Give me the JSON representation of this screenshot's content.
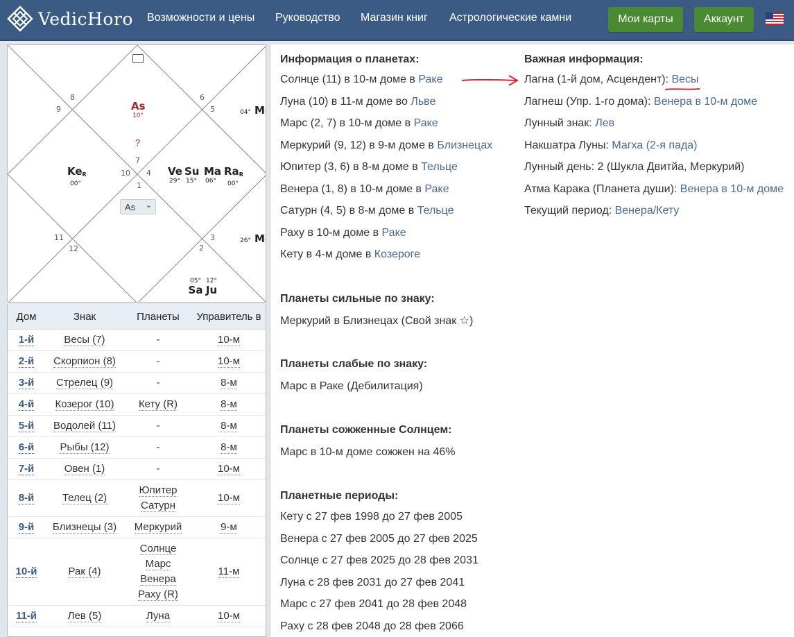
{
  "nav": {
    "logo_text": "VedicHoro",
    "links": [
      "Возможности и цены",
      "Руководство",
      "Магазин книг",
      "Астрологические камни"
    ],
    "my_charts": "Мои карты",
    "account": "Аккаунт"
  },
  "chart": {
    "house_numbers": [
      "1",
      "2",
      "3",
      "4",
      "5",
      "6",
      "7",
      "8",
      "9",
      "10",
      "11",
      "12"
    ],
    "asc": {
      "abbr": "As",
      "deg": "10°"
    },
    "question": "?",
    "ketu": {
      "abbr": "Ke",
      "deg": "00°",
      "sup": "R"
    },
    "venus": {
      "abbr": "Ve",
      "deg": "29°"
    },
    "sun": {
      "abbr": "Su",
      "deg": "15°"
    },
    "mars": {
      "abbr": "Ma",
      "deg": "06°"
    },
    "rahu": {
      "abbr": "Ra",
      "deg": "00°",
      "sup": "R"
    },
    "moon": {
      "abbr": "Mo",
      "deg": "04°"
    },
    "mercury": {
      "abbr": "Me",
      "deg": "26°"
    },
    "saturn": {
      "abbr": "Sa",
      "deg": "05°"
    },
    "jupiter": {
      "abbr": "Ju",
      "deg": "12°"
    },
    "select_value": "As"
  },
  "table": {
    "headers": [
      "Дом",
      "Знак",
      "Планеты",
      "Управитель в"
    ],
    "rows": [
      {
        "dom": "1-й",
        "sign": "Весы (7)",
        "planets": [
          "-"
        ],
        "lord": "10-м"
      },
      {
        "dom": "2-й",
        "sign": "Скорпион (8)",
        "planets": [
          "-"
        ],
        "lord": "10-м"
      },
      {
        "dom": "3-й",
        "sign": "Стрелец (9)",
        "planets": [
          "-"
        ],
        "lord": "8-м"
      },
      {
        "dom": "4-й",
        "sign": "Козерог (10)",
        "planets": [
          "Кету (R)"
        ],
        "lord": "8-м"
      },
      {
        "dom": "5-й",
        "sign": "Водолей (11)",
        "planets": [
          "-"
        ],
        "lord": "8-м"
      },
      {
        "dom": "6-й",
        "sign": "Рыбы (12)",
        "planets": [
          "-"
        ],
        "lord": "8-м"
      },
      {
        "dom": "7-й",
        "sign": "Овен (1)",
        "planets": [
          "-"
        ],
        "lord": "10-м"
      },
      {
        "dom": "8-й",
        "sign": "Телец (2)",
        "planets": [
          "Юпитер",
          "Сатурн"
        ],
        "lord": "10-м"
      },
      {
        "dom": "9-й",
        "sign": "Близнецы (3)",
        "planets": [
          "Меркурий"
        ],
        "lord": "9-м"
      },
      {
        "dom": "10-й",
        "sign": "Рак (4)",
        "planets": [
          "Солнце",
          "Марс",
          "Венера",
          "Раху (R)"
        ],
        "lord": "11-м"
      },
      {
        "dom": "11-й",
        "sign": "Лев (5)",
        "planets": [
          "Луна"
        ],
        "lord": "10-м"
      }
    ]
  },
  "info": {
    "planets_header": "Информация о планетах:",
    "planets": [
      {
        "text": "Солнце (11) в 10-м доме в ",
        "link": "Раке"
      },
      {
        "text": "Луна (10) в 11-м доме во ",
        "link": "Льве"
      },
      {
        "text": "Марс (2, 7) в 10-м доме в ",
        "link": "Раке"
      },
      {
        "text": "Меркурий (9, 12) в 9-м доме в ",
        "link": "Близнецах"
      },
      {
        "text": "Юпитер (3, 6) в 8-м доме в ",
        "link": "Тельце"
      },
      {
        "text": "Венера (1, 8) в 10-м доме в ",
        "link": "Раке"
      },
      {
        "text": "Сатурн (4, 5) в 8-м доме в ",
        "link": "Тельце"
      },
      {
        "text": "Раху в 10-м доме в ",
        "link": "Раке"
      },
      {
        "text": "Кету в 4-м доме в ",
        "link": "Козероге"
      }
    ],
    "important_header": "Важная информация:",
    "important": [
      {
        "text": "Лагна (1-й дом, Асцендент): ",
        "link": "Весы"
      },
      {
        "text": "Лагнеш (Упр. 1-го дома): ",
        "link": "Венера в 10-м доме"
      },
      {
        "text": "Лунный знак: ",
        "link": "Лев"
      },
      {
        "text": "Накшатра Луны: ",
        "link": "Магха (2-я пада)"
      },
      {
        "text": "Лунный день: 2 (Шукла Двитйа, Меркурий)",
        "link": ""
      },
      {
        "text": "Атма Карака (Планета души): ",
        "link": "Венера в 10-м доме"
      },
      {
        "text": "Текущий период: ",
        "link": "Венера/Кету"
      }
    ],
    "strong_header": "Планеты сильные по знаку:",
    "strong": "Меркурий в Близнецах (Свой знак ☆)",
    "weak_header": "Планеты слабые по знаку:",
    "weak": "Марс в Раке (Дебилитация)",
    "combust_header": "Планеты сожженные Солнцем:",
    "combust": "Марс в 10-м доме сожжен на 46%",
    "periods_header": "Планетные периоды:",
    "periods": [
      "Кету с 27 фев 1998 до 27 фев 2005",
      "Венера с 27 фев 2005 до 27 фев 2025",
      "Солнце с 27 фев 2025 до 28 фев 2031",
      "Луна с 28 фев 2031 до 27 фев 2041",
      "Марс с 27 фев 2041 до 28 фев 2048",
      "Раху с 28 фев 2048 до 28 фев 2066"
    ]
  },
  "colors": {
    "nav_bg": "#3b5b84",
    "button_green": "#4a8a32",
    "link": "#4a6a8f",
    "annotation_red": "#d9232e",
    "ascendant": "#a52a2a"
  }
}
